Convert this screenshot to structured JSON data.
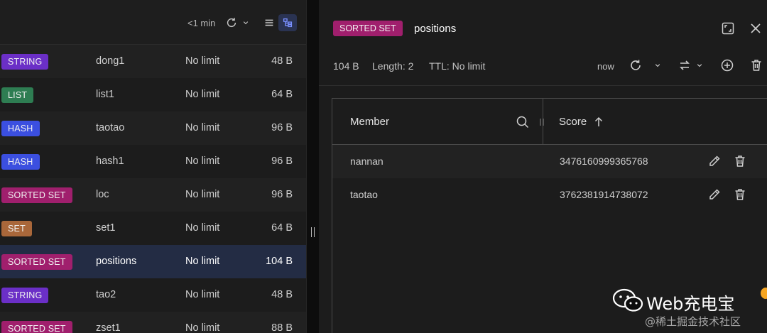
{
  "key_list": {
    "refresh_label": "<1 min",
    "rows": [
      {
        "type": "STRING",
        "type_color": "#6b2fc7",
        "name": "dong1",
        "ttl": "No limit",
        "size": "48 B"
      },
      {
        "type": "LIST",
        "type_color": "#2e7d52",
        "name": "list1",
        "ttl": "No limit",
        "size": "64 B"
      },
      {
        "type": "HASH",
        "type_color": "#3b4fe0",
        "name": "taotao",
        "ttl": "No limit",
        "size": "96 B"
      },
      {
        "type": "HASH",
        "type_color": "#3b4fe0",
        "name": "hash1",
        "ttl": "No limit",
        "size": "96 B"
      },
      {
        "type": "SORTED SET",
        "type_color": "#a01f6d",
        "name": "loc",
        "ttl": "No limit",
        "size": "96 B"
      },
      {
        "type": "SET",
        "type_color": "#a9673a",
        "name": "set1",
        "ttl": "No limit",
        "size": "64 B"
      },
      {
        "type": "SORTED SET",
        "type_color": "#a01f6d",
        "name": "positions",
        "ttl": "No limit",
        "size": "104 B",
        "selected": true
      },
      {
        "type": "STRING",
        "type_color": "#6b2fc7",
        "name": "tao2",
        "ttl": "No limit",
        "size": "48 B"
      },
      {
        "type": "SORTED SET",
        "type_color": "#a01f6d",
        "name": "zset1",
        "ttl": "No limit",
        "size": "88 B"
      }
    ]
  },
  "detail": {
    "type": "SORTED SET",
    "key": "positions",
    "size": "104 B",
    "length": "Length: 2",
    "ttl": "TTL:  No limit",
    "refreshed": "now",
    "columns": {
      "member": "Member",
      "score": "Score"
    },
    "rows": [
      {
        "member": "nannan",
        "score": "3476160999365768"
      },
      {
        "member": "taotao",
        "score": "3762381914738072"
      }
    ]
  },
  "watermark": {
    "title": "Web充电宝",
    "subtitle": "@稀土掘金技术社区"
  }
}
